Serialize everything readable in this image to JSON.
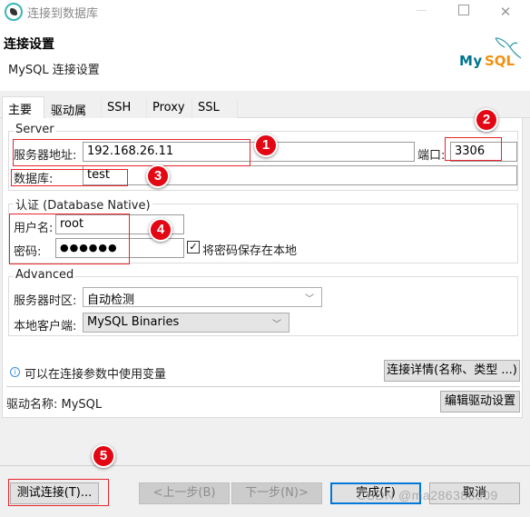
{
  "window": {
    "title": "连接到数据库",
    "icon": "dbeaver-beaver-icon",
    "controls": {
      "minimize": "—",
      "maximize": "☐",
      "close": "✕"
    }
  },
  "header": {
    "title": "连接设置",
    "subtitle": "MySQL 连接设置",
    "logo": {
      "my": "My",
      "sql": "SQL",
      "colors": {
        "my": "#00758f",
        "sql": "#f29111"
      }
    }
  },
  "tabs": [
    {
      "label": "主要",
      "active": true
    },
    {
      "label": "驱动属性",
      "active": false
    },
    {
      "label": "SSH",
      "active": false
    },
    {
      "label": "Proxy",
      "active": false
    },
    {
      "label": "SSL",
      "active": false
    }
  ],
  "server": {
    "group_label": "Server",
    "host_label": "服务器地址:",
    "host_value": "192.168.26.11",
    "port_label": "端口:",
    "port_value": "3306",
    "database_label": "数据库:",
    "database_value": "test"
  },
  "auth": {
    "group_label": "认证 (Database Native)",
    "user_label": "用户名:",
    "user_value": "root",
    "password_label": "密码:",
    "password_value": "●●●●●●",
    "save_password_label": "将密码保存在本地",
    "save_password_checked": true,
    "check_mark": "✓"
  },
  "advanced": {
    "group_label": "Advanced",
    "timezone_label": "服务器时区:",
    "timezone_value": "自动检测",
    "client_label": "本地客户端:",
    "client_value": "MySQL Binaries",
    "chevron": "﹀"
  },
  "info": {
    "icon_glyph": "i",
    "text": "可以在连接参数中使用变量",
    "details_button": "连接详情(名称、类型 ...)"
  },
  "driver": {
    "label": "驱动名称: MySQL",
    "edit_button": "编辑驱动设置"
  },
  "footer": {
    "test_button": "测试连接(T)...",
    "back_button": "<上一步(B)",
    "next_button": "下一步(N)>",
    "finish_button": "完成(F)",
    "cancel_button": "取消"
  },
  "annotations": {
    "badges": [
      "1",
      "2",
      "3",
      "4",
      "5"
    ],
    "highlight_color": "#e8242c",
    "badge_color": "#e30613"
  },
  "watermark": "CSDN @ma286388309"
}
